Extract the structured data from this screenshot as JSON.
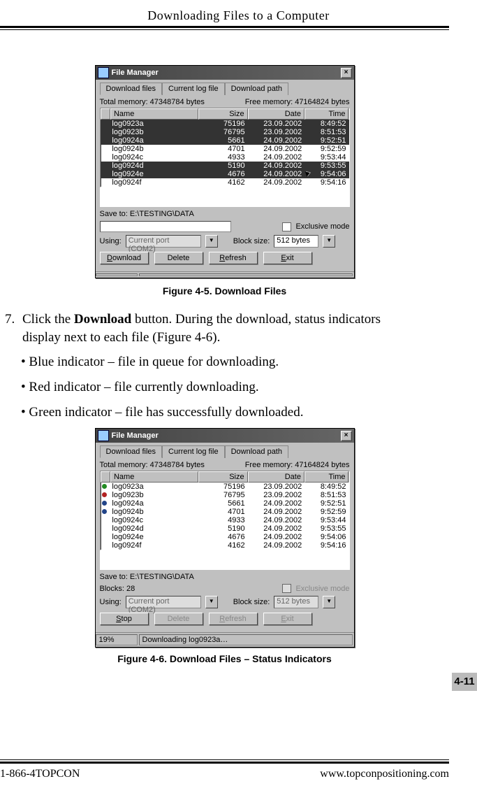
{
  "header": {
    "title": "Downloading Files to a Computer"
  },
  "fig1": {
    "caption": "Figure 4-5. Download Files",
    "window_title": "File Manager",
    "tabs": [
      "Download files",
      "Current log file",
      "Download path"
    ],
    "total_memory_label": "Total memory: 47348784 bytes",
    "free_memory_label": "Free memory: 47164824 bytes",
    "columns": {
      "name": "Name",
      "size": "Size",
      "date": "Date",
      "time": "Time"
    },
    "rows": [
      {
        "name": "log0923a",
        "size": "75196",
        "date": "23.09.2002",
        "time": "8:49:52",
        "sel": true
      },
      {
        "name": "log0923b",
        "size": "76795",
        "date": "23.09.2002",
        "time": "8:51:53",
        "sel": true
      },
      {
        "name": "log0924a",
        "size": "5661",
        "date": "24.09.2002",
        "time": "9:52:51",
        "sel": true
      },
      {
        "name": "log0924b",
        "size": "4701",
        "date": "24.09.2002",
        "time": "9:52:59",
        "sel": false
      },
      {
        "name": "log0924c",
        "size": "4933",
        "date": "24.09.2002",
        "time": "9:53:44",
        "sel": false
      },
      {
        "name": "log0924d",
        "size": "5190",
        "date": "24.09.2002",
        "time": "9:53:55",
        "sel": true
      },
      {
        "name": "log0924e",
        "size": "4676",
        "date": "24.09.2002",
        "time": "9:54:06",
        "sel": true
      },
      {
        "name": "log0924f",
        "size": "4162",
        "date": "24.09.2002",
        "time": "9:54:16",
        "sel": false
      }
    ],
    "save_to": "Save to: E:\\TESTING\\DATA",
    "exclusive_label": "Exclusive mode",
    "using_label": "Using:",
    "using_value": "Current port (COM2)",
    "block_label": "Block size:",
    "block_value": "512 bytes",
    "btn_download": "Download",
    "btn_delete": "Delete",
    "btn_refresh": "Refresh",
    "btn_exit": "Exit"
  },
  "step7_pre": "Click the ",
  "step7_bold": "Download",
  "step7_post": " button. During the download, status indicators display next to each file (Figure 4-6).",
  "bullet1": "Blue indicator – file in queue for downloading.",
  "bullet2": "Red indicator – file currently downloading.",
  "bullet3": "Green indicator – file has successfully downloaded.",
  "fig2": {
    "caption": "Figure 4-6. Download Files – Status Indicators",
    "window_title": "File Manager",
    "tabs": [
      "Download files",
      "Current log file",
      "Download path"
    ],
    "total_memory_label": "Total memory: 47348784 bytes",
    "free_memory_label": "Free memory: 47164824 bytes",
    "columns": {
      "name": "Name",
      "size": "Size",
      "date": "Date",
      "time": "Time"
    },
    "rows": [
      {
        "name": "log0923a",
        "size": "75196",
        "date": "23.09.2002",
        "time": "8:49:52",
        "dot": "green"
      },
      {
        "name": "log0923b",
        "size": "76795",
        "date": "23.09.2002",
        "time": "8:51:53",
        "dot": "red"
      },
      {
        "name": "log0924a",
        "size": "5661",
        "date": "24.09.2002",
        "time": "9:52:51",
        "dot": "blue"
      },
      {
        "name": "log0924b",
        "size": "4701",
        "date": "24.09.2002",
        "time": "9:52:59",
        "dot": "blue"
      },
      {
        "name": "log0924c",
        "size": "4933",
        "date": "24.09.2002",
        "time": "9:53:44",
        "dot": ""
      },
      {
        "name": "log0924d",
        "size": "5190",
        "date": "24.09.2002",
        "time": "9:53:55",
        "dot": ""
      },
      {
        "name": "log0924e",
        "size": "4676",
        "date": "24.09.2002",
        "time": "9:54:06",
        "dot": ""
      },
      {
        "name": "log0924f",
        "size": "4162",
        "date": "24.09.2002",
        "time": "9:54:16",
        "dot": ""
      }
    ],
    "save_to": "Save to: E:\\TESTING\\DATA",
    "blocks_label": "Blocks: 28",
    "exclusive_label": "Exclusive mode",
    "using_label": "Using:",
    "using_value": "Current port (COM2)",
    "block_label": "Block size:",
    "block_value": "512 bytes",
    "btn_stop": "Stop",
    "btn_delete": "Delete",
    "btn_refresh": "Refresh",
    "btn_exit": "Exit",
    "status_percent": "19%",
    "status_text": "Downloading log0923a…"
  },
  "page_num": "4-11",
  "footer": {
    "left": "1-866-4TOPCON",
    "right": "www.topconpositioning.com"
  }
}
